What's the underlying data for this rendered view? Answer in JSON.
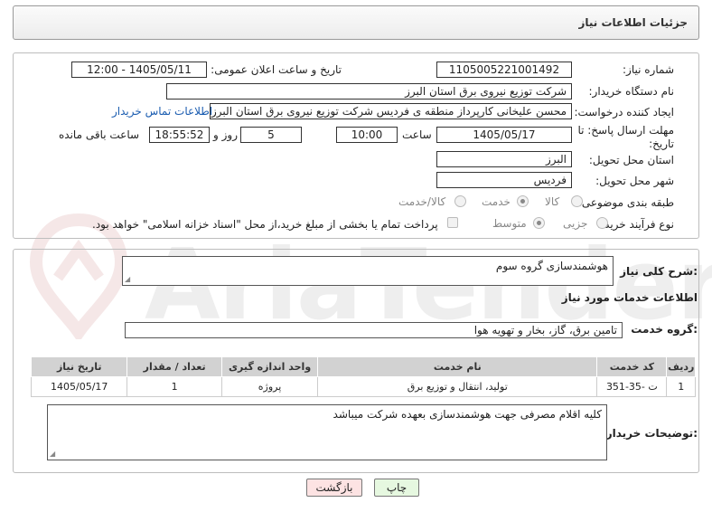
{
  "header": {
    "title": "جزئیات اطلاعات نیاز"
  },
  "fields": {
    "need_number_label": "شماره نیاز:",
    "need_number": "1105005221001492",
    "announce_label": "تاریخ و ساعت اعلان عمومی:",
    "announce_value": "1405/05/11 - 12:00",
    "buyer_org_label": "نام دستگاه خریدار:",
    "buyer_org": "شرکت توزیع نیروی برق استان البرز",
    "creator_label": "ایجاد کننده درخواست:",
    "creator": "محسن علیخانی کارپرداز منطقه ی فردیس شرکت توزیع نیروی برق استان البرز",
    "contact_link": "اطلاعات تماس خریدار",
    "deadline_label_1": "مهلت ارسال پاسخ: تا",
    "deadline_label_2": "تاریخ:",
    "deadline_date": "1405/05/17",
    "time_label": "ساعت",
    "deadline_time": "10:00",
    "days_value": "5",
    "days_label": "روز و",
    "remaining_time": "18:55:52",
    "remaining_label": "ساعت باقی مانده",
    "province_label": "استان محل تحویل:",
    "province": "البرز",
    "city_label": "شهر محل تحویل:",
    "city": "فردیس",
    "category_label": "طبقه بندی موضوعی:",
    "category_options": [
      "کالا",
      "خدمت",
      "کالا/خدمت"
    ],
    "category_selected": "خدمت",
    "process_label": "نوع فرآیند خرید :",
    "process_options": [
      "جزیی",
      "متوسط"
    ],
    "process_selected": "متوسط",
    "payment_note": "پرداخت تمام یا بخشی از مبلغ خرید،از محل \"اسناد خزانه اسلامی\" خواهد بود."
  },
  "need_desc": {
    "label": "شرح کلی نیاز:",
    "value": "هوشمندسازی گروه سوم"
  },
  "services": {
    "section_title": "اطلاعات خدمات مورد نیاز",
    "group_label": "گروه خدمت:",
    "group_value": "تامین برق، گاز، بخار و تهویه هوا",
    "columns": [
      "ردیف",
      "کد خدمت",
      "نام خدمت",
      "واحد اندازه گیری",
      "تعداد / مقدار",
      "تاریخ نیاز"
    ],
    "rows": [
      [
        "1",
        "ت -35-351",
        "تولید، انتقال و توزیع برق",
        "پروژه",
        "1",
        "1405/05/17"
      ]
    ]
  },
  "buyer_notes": {
    "label": "توضیحات خریدار:",
    "value": "کلیه اقلام مصرفی جهت هوشمندسازی بعهده شرکت میباشد"
  },
  "buttons": {
    "print": "چاپ",
    "back": "بازگشت"
  },
  "watermark": {
    "text": "AriaTender.neT"
  },
  "colors": {
    "link": "#1a5cb0",
    "back_btn_bg": "#fde3e3",
    "print_btn_bg": "#e6f8e0",
    "header_bg": "#ececec"
  }
}
